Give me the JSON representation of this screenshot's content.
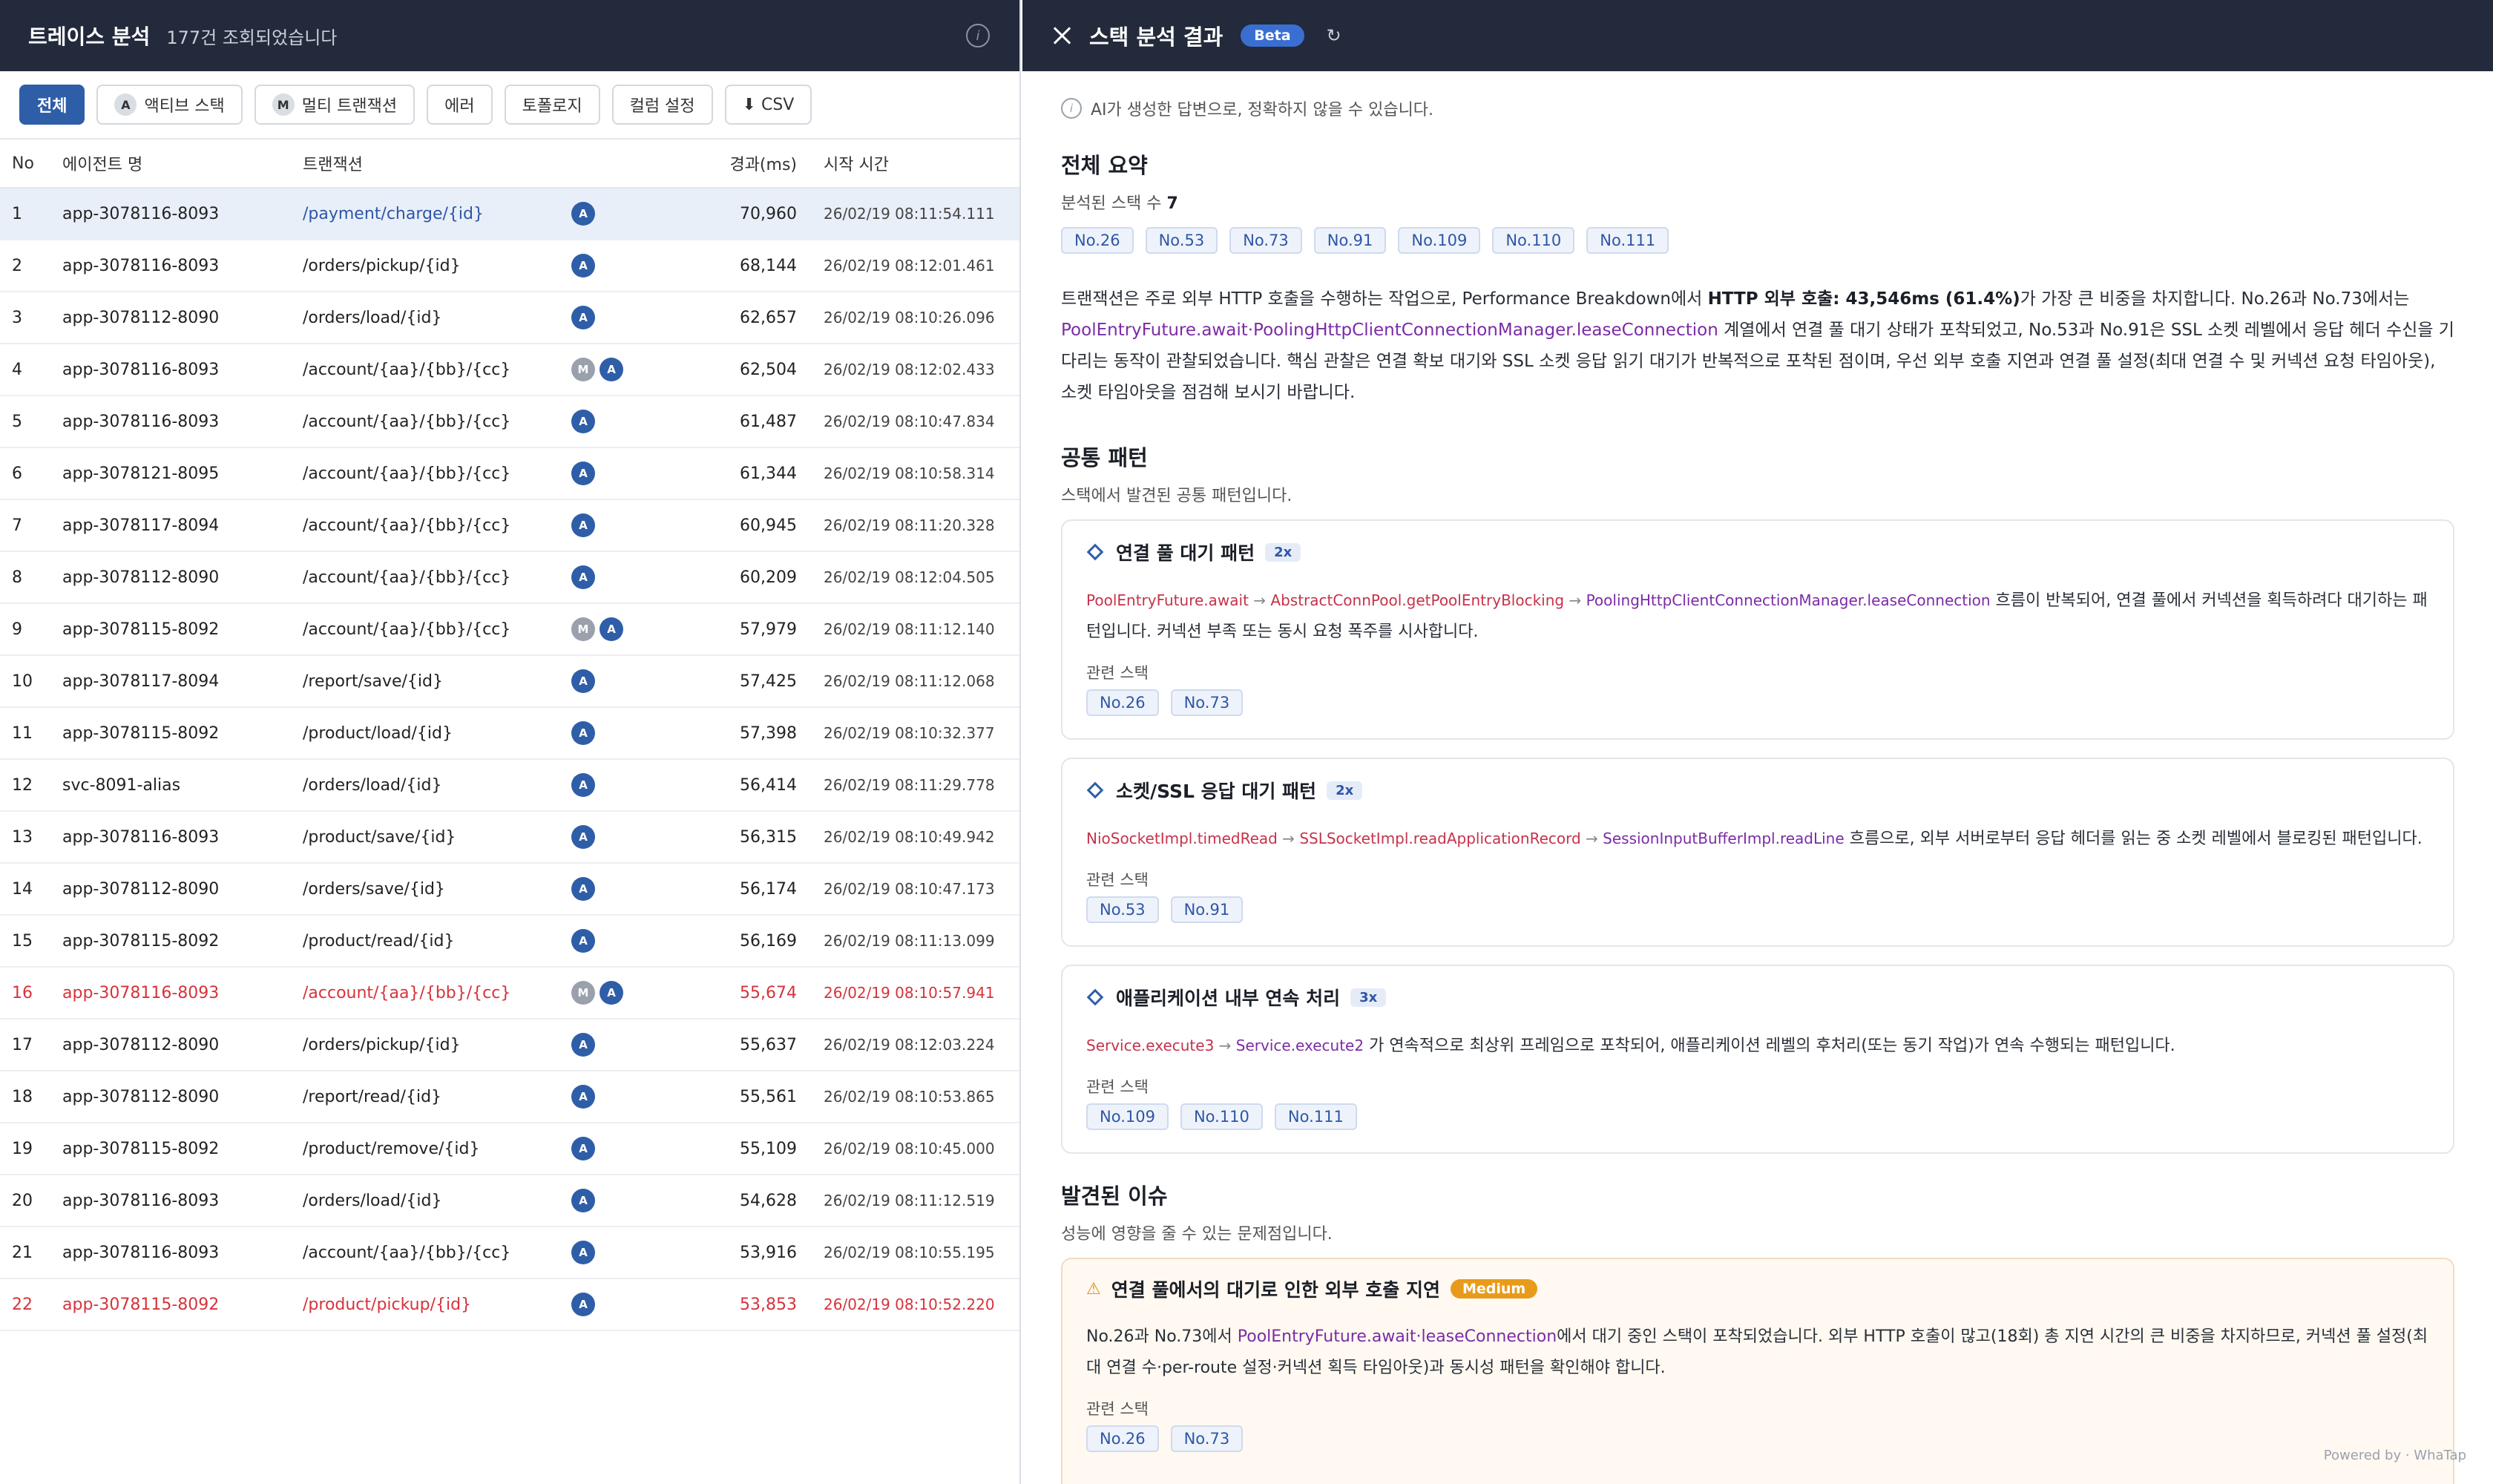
{
  "left": {
    "title": "트레이스 분석",
    "count_text": "177건 조회되었습니다",
    "filters": [
      {
        "label": "전체",
        "badge": "",
        "active": true
      },
      {
        "label": "액티브 스택",
        "badge": "A",
        "active": false
      },
      {
        "label": "멀티 트랜잭션",
        "badge": "M",
        "active": false
      },
      {
        "label": "에러",
        "badge": "",
        "active": false
      },
      {
        "label": "토폴로지",
        "badge": "",
        "active": false
      },
      {
        "label": "컬럼 설정",
        "badge": "",
        "active": false
      },
      {
        "label": "⬇ CSV",
        "badge": "",
        "active": false
      }
    ],
    "columns": [
      "No",
      "에이전트 명",
      "트랜잭션",
      "경과(ms)",
      "시작 시간"
    ],
    "rows": [
      {
        "no": "1",
        "agent": "app-3078116-8093",
        "tx": "/payment/charge/{id}",
        "badges": [
          "A"
        ],
        "elapsed": "70,960",
        "time": "26/02/19 08:11:54.111",
        "selected": true,
        "error": false
      },
      {
        "no": "2",
        "agent": "app-3078116-8093",
        "tx": "/orders/pickup/{id}",
        "badges": [
          "A"
        ],
        "elapsed": "68,144",
        "time": "26/02/19 08:12:01.461",
        "selected": false,
        "error": false
      },
      {
        "no": "3",
        "agent": "app-3078112-8090",
        "tx": "/orders/load/{id}",
        "badges": [
          "A"
        ],
        "elapsed": "62,657",
        "time": "26/02/19 08:10:26.096",
        "selected": false,
        "error": false
      },
      {
        "no": "4",
        "agent": "app-3078116-8093",
        "tx": "/account/{aa}/{bb}/{cc}",
        "badges": [
          "M",
          "A"
        ],
        "elapsed": "62,504",
        "time": "26/02/19 08:12:02.433",
        "selected": false,
        "error": false
      },
      {
        "no": "5",
        "agent": "app-3078116-8093",
        "tx": "/account/{aa}/{bb}/{cc}",
        "badges": [
          "A"
        ],
        "elapsed": "61,487",
        "time": "26/02/19 08:10:47.834",
        "selected": false,
        "error": false
      },
      {
        "no": "6",
        "agent": "app-3078121-8095",
        "tx": "/account/{aa}/{bb}/{cc}",
        "badges": [
          "A"
        ],
        "elapsed": "61,344",
        "time": "26/02/19 08:10:58.314",
        "selected": false,
        "error": false
      },
      {
        "no": "7",
        "agent": "app-3078117-8094",
        "tx": "/account/{aa}/{bb}/{cc}",
        "badges": [
          "A"
        ],
        "elapsed": "60,945",
        "time": "26/02/19 08:11:20.328",
        "selected": false,
        "error": false
      },
      {
        "no": "8",
        "agent": "app-3078112-8090",
        "tx": "/account/{aa}/{bb}/{cc}",
        "badges": [
          "A"
        ],
        "elapsed": "60,209",
        "time": "26/02/19 08:12:04.505",
        "selected": false,
        "error": false
      },
      {
        "no": "9",
        "agent": "app-3078115-8092",
        "tx": "/account/{aa}/{bb}/{cc}",
        "badges": [
          "M",
          "A"
        ],
        "elapsed": "57,979",
        "time": "26/02/19 08:11:12.140",
        "selected": false,
        "error": false
      },
      {
        "no": "10",
        "agent": "app-3078117-8094",
        "tx": "/report/save/{id}",
        "badges": [
          "A"
        ],
        "elapsed": "57,425",
        "time": "26/02/19 08:11:12.068",
        "selected": false,
        "error": false
      },
      {
        "no": "11",
        "agent": "app-3078115-8092",
        "tx": "/product/load/{id}",
        "badges": [
          "A"
        ],
        "elapsed": "57,398",
        "time": "26/02/19 08:10:32.377",
        "selected": false,
        "error": false
      },
      {
        "no": "12",
        "agent": "svc-8091-alias",
        "tx": "/orders/load/{id}",
        "badges": [
          "A"
        ],
        "elapsed": "56,414",
        "time": "26/02/19 08:11:29.778",
        "selected": false,
        "error": false
      },
      {
        "no": "13",
        "agent": "app-3078116-8093",
        "tx": "/product/save/{id}",
        "badges": [
          "A"
        ],
        "elapsed": "56,315",
        "time": "26/02/19 08:10:49.942",
        "selected": false,
        "error": false
      },
      {
        "no": "14",
        "agent": "app-3078112-8090",
        "tx": "/orders/save/{id}",
        "badges": [
          "A"
        ],
        "elapsed": "56,174",
        "time": "26/02/19 08:10:47.173",
        "selected": false,
        "error": false
      },
      {
        "no": "15",
        "agent": "app-3078115-8092",
        "tx": "/product/read/{id}",
        "badges": [
          "A"
        ],
        "elapsed": "56,169",
        "time": "26/02/19 08:11:13.099",
        "selected": false,
        "error": false
      },
      {
        "no": "16",
        "agent": "app-3078116-8093",
        "tx": "/account/{aa}/{bb}/{cc}",
        "badges": [
          "M",
          "A"
        ],
        "elapsed": "55,674",
        "time": "26/02/19 08:10:57.941",
        "selected": false,
        "error": true
      },
      {
        "no": "17",
        "agent": "app-3078112-8090",
        "tx": "/orders/pickup/{id}",
        "badges": [
          "A"
        ],
        "elapsed": "55,637",
        "time": "26/02/19 08:12:03.224",
        "selected": false,
        "error": false
      },
      {
        "no": "18",
        "agent": "app-3078112-8090",
        "tx": "/report/read/{id}",
        "badges": [
          "A"
        ],
        "elapsed": "55,561",
        "time": "26/02/19 08:10:53.865",
        "selected": false,
        "error": false
      },
      {
        "no": "19",
        "agent": "app-3078115-8092",
        "tx": "/product/remove/{id}",
        "badges": [
          "A"
        ],
        "elapsed": "55,109",
        "time": "26/02/19 08:10:45.000",
        "selected": false,
        "error": false
      },
      {
        "no": "20",
        "agent": "app-3078116-8093",
        "tx": "/orders/load/{id}",
        "badges": [
          "A"
        ],
        "elapsed": "54,628",
        "time": "26/02/19 08:11:12.519",
        "selected": false,
        "error": false
      },
      {
        "no": "21",
        "agent": "app-3078116-8093",
        "tx": "/account/{aa}/{bb}/{cc}",
        "badges": [
          "A"
        ],
        "elapsed": "53,916",
        "time": "26/02/19 08:10:55.195",
        "selected": false,
        "error": false
      },
      {
        "no": "22",
        "agent": "app-3078115-8092",
        "tx": "/product/pickup/{id}",
        "badges": [
          "A"
        ],
        "elapsed": "53,853",
        "time": "26/02/19 08:10:52.220",
        "selected": false,
        "error": true
      }
    ]
  },
  "right": {
    "title": "스택 분석 결과",
    "beta": "Beta",
    "refresh_glyph": "↻",
    "disclaimer": "AI가 생성한 답변으로, 정확하지 않을 수 있습니다.",
    "summary": {
      "heading": "전체 요약",
      "count_label": "분석된 스택 수",
      "count_value": "7",
      "tags": [
        "No.26",
        "No.53",
        "No.73",
        "No.91",
        "No.109",
        "No.110",
        "No.111"
      ],
      "p1": "트랜잭션은 주로 외부 HTTP 호출을 수행하는 작업으로, Performance Breakdown에서 ",
      "p_bold": "HTTP 외부 호출: 43,546ms (61.4%)",
      "p2": "가 가장 큰 비중을 차지합니다. No.26과 No.73에서는 ",
      "p_code": "PoolEntryFuture.await·PoolingHttpClientConnectionManager.leaseConnection",
      "p3": " 계열에서 연결 풀 대기 상태가 포착되었고, No.53과 No.91은 SSL 소켓 레벨에서 응답 헤더 수신을 기다리는 동작이 관찰되었습니다. 핵심 관찰은 연결 확보 대기와 SSL 소켓 응답 읽기 대기가 반복적으로 포착된 점이며, 우선 외부 호출 지연과 연결 풀 설정(최대 연결 수 및 커넥션 요청 타임아웃), 소켓 타임아웃을 점검해 보시기 바랍니다."
    },
    "patterns": {
      "heading": "공통 패턴",
      "sub": "스택에서 발견된 공통 패턴입니다.",
      "related_label": "관련 스택",
      "cards": [
        {
          "title": "연결 풀 대기 패턴",
          "count": "2x",
          "chain": [
            "PoolEntryFuture.await",
            "AbstractConnPool.getPoolEntryBlocking",
            "PoolingHttpClientConnectionManager.leaseConnection"
          ],
          "desc": " 흐름이 반복되어, 연결 풀에서 커넥션을 획득하려다 대기하는 패턴입니다. 커넥션 부족 또는 동시 요청 폭주를 시사합니다.",
          "tags": [
            "No.26",
            "No.73"
          ]
        },
        {
          "title": "소켓/SSL 응답 대기 패턴",
          "count": "2x",
          "chain": [
            "NioSocketImpl.timedRead",
            "SSLSocketImpl.readApplicationRecord",
            "SessionInputBufferImpl.readLine"
          ],
          "desc": " 흐름으로, 외부 서버로부터 응답 헤더를 읽는 중 소켓 레벨에서 블로킹된 패턴입니다.",
          "tags": [
            "No.53",
            "No.91"
          ]
        },
        {
          "title": "애플리케이션 내부 연속 처리",
          "count": "3x",
          "chain": [
            "Service.execute3",
            "Service.execute2"
          ],
          "desc": " 가 연속적으로 최상위 프레임으로 포착되어, 애플리케이션 레벨의 후처리(또는 동기 작업)가 연속 수행되는 패턴입니다.",
          "tags": [
            "No.109",
            "No.110",
            "No.111"
          ]
        }
      ]
    },
    "issues": {
      "heading": "발견된 이슈",
      "sub": "성능에 영향을 줄 수 있는 문제점입니다.",
      "items": [
        {
          "title": "연결 풀에서의 대기로 인한 외부 호출 지연",
          "severity": "Medium",
          "d1": "No.26과 No.73에서 ",
          "d_code": "PoolEntryFuture.await·leaseConnection",
          "d2": "에서 대기 중인 스택이 포착되었습니다. 외부 HTTP 호출이 많고(18회) 총 지연 시간의 큰 비중을 차지하므로, 커넥션 풀 설정(최대 연결 수·per-route 설정·커넥션 획득 타임아웃)과 동시성 패턴을 확인해야 합니다.",
          "related_label": "관련 스택",
          "tags": [
            "No.26",
            "No.73"
          ]
        }
      ]
    },
    "powered": "Powered by · WhaTap"
  },
  "colors": {
    "header_bg": "#222a3b",
    "accent": "#2f5ea8",
    "error": "#d6333b",
    "code": "#7b2ba6",
    "warning": "#e89b1a"
  }
}
